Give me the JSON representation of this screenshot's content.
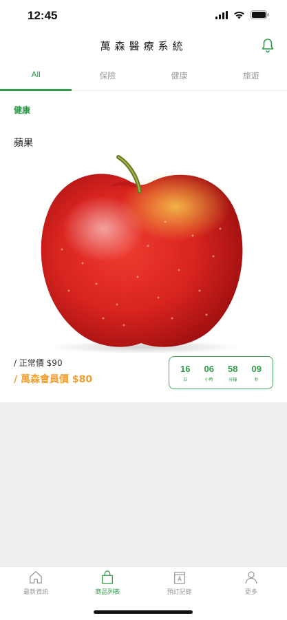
{
  "status": {
    "time": "12:45"
  },
  "header": {
    "title": "萬森醫療系統",
    "bell_icon": "bell-icon"
  },
  "tabs": [
    {
      "label": "All",
      "active": true
    },
    {
      "label": "保險",
      "active": false
    },
    {
      "label": "健康",
      "active": false
    },
    {
      "label": "旅遊",
      "active": false
    }
  ],
  "product": {
    "category": "健康",
    "name": "蘋果",
    "image_icon": "apple-image",
    "price_normal": "/ 正常價 $90",
    "price_member": "/ 萬森會員價 $80"
  },
  "countdown": [
    {
      "value": "16",
      "unit": "日"
    },
    {
      "value": "06",
      "unit": "小時"
    },
    {
      "value": "58",
      "unit": "分鐘"
    },
    {
      "value": "09",
      "unit": "秒"
    }
  ],
  "tabbar": [
    {
      "label": "最新資訊",
      "icon": "home-icon",
      "active": false
    },
    {
      "label": "商品列表",
      "icon": "bag-icon",
      "active": true
    },
    {
      "label": "預訂記錄",
      "icon": "calendar-icon",
      "active": false
    },
    {
      "label": "更多",
      "icon": "person-icon",
      "active": false
    }
  ],
  "colors": {
    "accent": "#2f9a48",
    "member_price": "#f0a030",
    "background_grey": "#efefef"
  }
}
